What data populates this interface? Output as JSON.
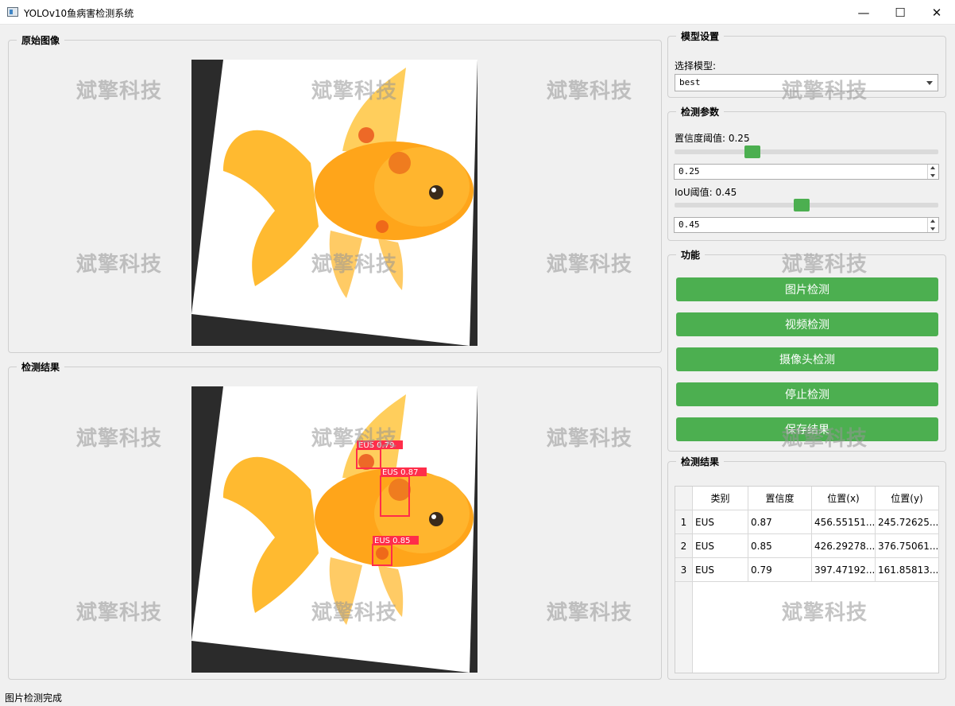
{
  "window": {
    "title": "YOLOv10鱼病害检测系统",
    "minimize_glyph": "—",
    "maximize_glyph": "☐",
    "close_glyph": "✕"
  },
  "watermark": "斌擎科技",
  "original_panel": {
    "title": "原始图像"
  },
  "result_panel": {
    "title": "检测结果"
  },
  "detections_boxes": [
    {
      "label": "EUS 0.79"
    },
    {
      "label": "EUS 0.87"
    },
    {
      "label": "EUS 0.85"
    }
  ],
  "model_settings": {
    "title": "模型设置",
    "select_label": "选择模型:",
    "selected_model": "best"
  },
  "detect_params": {
    "title": "检测参数",
    "conf_label": "置信度阈值: 0.25",
    "conf_value": "0.25",
    "conf_level": 0.25,
    "iou_label": "IoU阈值: 0.45",
    "iou_value": "0.45",
    "iou_level": 0.45
  },
  "functions": {
    "title": "功能",
    "buttons": [
      "图片检测",
      "视频检测",
      "摄像头检测",
      "停止检测",
      "保存结果"
    ]
  },
  "results_table": {
    "title": "检测结果",
    "headers": [
      "类别",
      "置信度",
      "位置(x)",
      "位置(y)"
    ],
    "rows": [
      {
        "index": "1",
        "cls": "EUS",
        "conf": "0.87",
        "x": "456.55151...",
        "y": "245.72625..."
      },
      {
        "index": "2",
        "cls": "EUS",
        "conf": "0.85",
        "x": "426.29278...",
        "y": "376.75061..."
      },
      {
        "index": "3",
        "cls": "EUS",
        "conf": "0.79",
        "x": "397.47192...",
        "y": "161.85813..."
      }
    ]
  },
  "status_bar": {
    "text": "图片检测完成"
  },
  "colors": {
    "accent": "#4caf50",
    "detection_box": "#ff2d4a"
  }
}
